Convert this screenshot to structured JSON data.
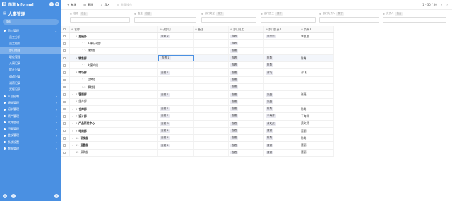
{
  "sidebar": {
    "brand": "简道 Informal",
    "app_title": "人事管理",
    "search_placeholder": "搜索",
    "items": [
      {
        "label": "员工管理",
        "level": 0,
        "expanded": true
      },
      {
        "label": "员工分析",
        "level": 1
      },
      {
        "label": "员工档案",
        "level": 1
      },
      {
        "label": "部门管理",
        "level": 1,
        "active": true
      },
      {
        "label": "职位管理",
        "level": 1
      },
      {
        "label": "入离记录",
        "level": 1
      },
      {
        "label": "转正记录",
        "level": 1
      },
      {
        "label": "调动记录",
        "level": 1
      },
      {
        "label": "调薪记录",
        "level": 1
      },
      {
        "label": "奖惩记录",
        "level": 1
      },
      {
        "label": "人员招聘",
        "level": 0
      },
      {
        "label": "绩效管理",
        "level": 0
      },
      {
        "label": "培训管理",
        "level": 0
      },
      {
        "label": "资产管理",
        "level": 0
      },
      {
        "label": "文件管理",
        "level": 0
      },
      {
        "label": "行政管理",
        "level": 0
      },
      {
        "label": "会议管理",
        "level": 0
      },
      {
        "label": "系统设置",
        "level": 0
      },
      {
        "label": "数据管理",
        "level": 0
      }
    ]
  },
  "toolbar": {
    "new_label": "新增",
    "delete_label": "删除",
    "import_label": "导入",
    "export_label": "批量操作",
    "page_info": "1 - 30 / 30",
    "prev": "‹",
    "next": "›"
  },
  "filters": [
    {
      "label": "名称",
      "mode": "包含"
    },
    {
      "label": "备注",
      "mode": "包含"
    },
    {
      "label": "部门类型",
      "mode": "等于"
    },
    {
      "label": "部门员工",
      "mode": "属于"
    },
    {
      "label": "部门负责人",
      "mode": "属于"
    },
    {
      "label": "负责人",
      "mode": "包含"
    }
  ],
  "columns": [
    "名称",
    "子部门",
    "备注",
    "部门员工",
    "部门负责人",
    "负责人"
  ],
  "rows": [
    {
      "num": "1",
      "name": "总经办",
      "exp": "⌄",
      "indent": 0,
      "bold": true,
      "sub": "查看 2",
      "type": "查看",
      "leader": "李思思",
      "owner": "李思思"
    },
    {
      "num": "1.1",
      "name": "人事行政部",
      "exp": "",
      "indent": 1,
      "bold": false,
      "sub": "",
      "type": "查看",
      "leader": "",
      "owner": ""
    },
    {
      "num": "1.2",
      "name": "财务部",
      "exp": "",
      "indent": 1,
      "bold": false,
      "sub": "",
      "type": "查看",
      "leader": "",
      "owner": ""
    },
    {
      "num": "2",
      "name": "销售部",
      "exp": "⌄",
      "indent": 0,
      "bold": true,
      "sub": "查看 1",
      "type": "查看",
      "leader": "陈勇",
      "owner": "陈勇",
      "hl": true
    },
    {
      "num": "2.1",
      "name": "大客户组",
      "exp": "",
      "indent": 1,
      "bold": false,
      "sub": "",
      "type": "查看",
      "leader": "陈勇",
      "owner": ""
    },
    {
      "num": "3",
      "name": "市场部",
      "exp": "⌄",
      "indent": 0,
      "bold": true,
      "sub": "查看 1",
      "type": "查看",
      "leader": "邓飞",
      "owner": "邓飞"
    },
    {
      "num": "3.1",
      "name": "品牌组",
      "exp": "",
      "indent": 1,
      "bold": false,
      "sub": "",
      "type": "查看",
      "leader": "",
      "owner": ""
    },
    {
      "num": "3.2",
      "name": "策划组",
      "exp": "",
      "indent": 1,
      "bold": false,
      "sub": "",
      "type": "查看",
      "leader": "",
      "owner": ""
    },
    {
      "num": "4",
      "name": "客服部",
      "exp": "›",
      "indent": 0,
      "bold": true,
      "sub": "查看 1",
      "type": "查看",
      "leader": "张磊",
      "owner": "张磊"
    },
    {
      "num": "5",
      "name": "生产部",
      "exp": "",
      "indent": 0,
      "bold": false,
      "sub": "",
      "type": "查看",
      "leader": "张磊",
      "owner": ""
    },
    {
      "num": "6",
      "name": "仓库部",
      "exp": "›",
      "indent": 0,
      "bold": true,
      "sub": "查看 1",
      "type": "查看",
      "leader": "陈勇",
      "owner": "陈勇"
    },
    {
      "num": "7",
      "name": "设计部",
      "exp": "›",
      "indent": 0,
      "bold": true,
      "sub": "查看 1",
      "type": "查看",
      "leader": "于海洋",
      "owner": "于海洋"
    },
    {
      "num": "8",
      "name": "产品研发中心",
      "exp": "›",
      "indent": 0,
      "bold": true,
      "sub": "查看 3",
      "type": "查看",
      "leader": "黄文武",
      "owner": "黄文武"
    },
    {
      "num": "9",
      "name": "电商部",
      "exp": "›",
      "indent": 0,
      "bold": true,
      "sub": "查看 1",
      "type": "查看",
      "leader": "董丽",
      "owner": "董丽"
    },
    {
      "num": "10",
      "name": "研发部",
      "exp": "›",
      "indent": 0,
      "bold": true,
      "sub": "查看 4",
      "type": "查看",
      "leader": "陈勇",
      "owner": "陈勇"
    },
    {
      "num": "11",
      "name": "运营部",
      "exp": "›",
      "indent": 0,
      "bold": true,
      "sub": "查看 1",
      "type": "查看",
      "leader": "董丽",
      "owner": "董丽"
    },
    {
      "num": "12",
      "name": "采购部",
      "exp": "",
      "indent": 0,
      "bold": false,
      "sub": "",
      "type": "查看",
      "leader": "董丽",
      "owner": "董丽"
    }
  ],
  "colors": {
    "sidebar": "#4a90e2",
    "accent": "#4a90e2"
  }
}
